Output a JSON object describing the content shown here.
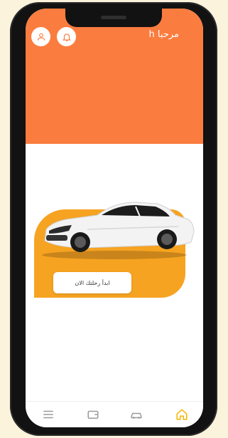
{
  "header": {
    "greeting": "مرحبا h"
  },
  "promo": {
    "start_button_label": "ابدأ رحلتك الان"
  },
  "status_bar": {
    "left": "",
    "right": ""
  },
  "tabbar": {
    "items": [
      {
        "icon": "menu-icon"
      },
      {
        "icon": "wallet-icon"
      },
      {
        "icon": "car-icon"
      },
      {
        "icon": "home-icon",
        "active": true
      }
    ],
    "active_color": "#f2b400"
  },
  "colors": {
    "header": "#fb7c3f",
    "promo": "#f6a321",
    "page_background": "#fbf3dc"
  }
}
